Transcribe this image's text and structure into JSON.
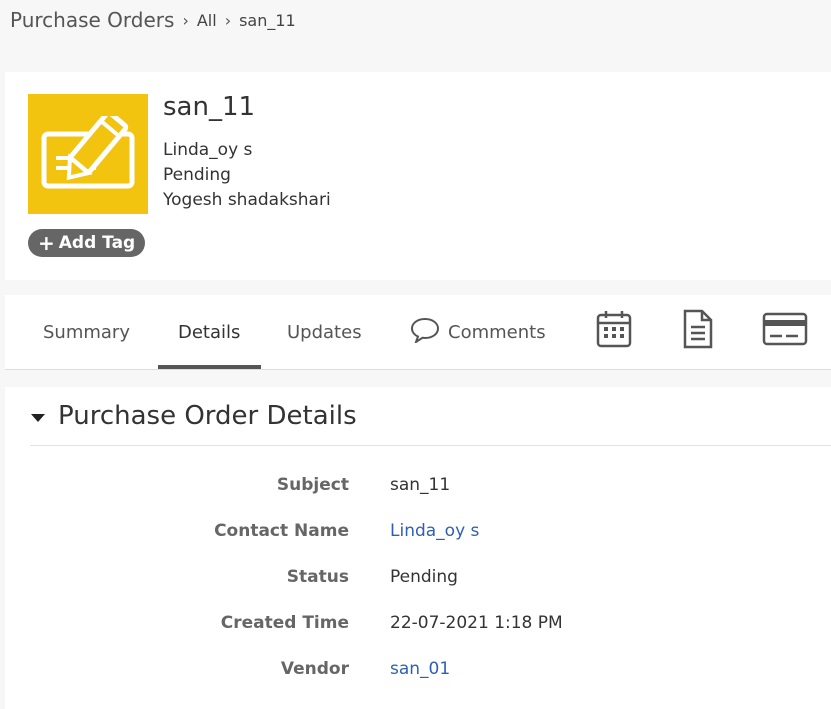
{
  "breadcrumb": {
    "module": "Purchase Orders",
    "all": "All",
    "record": "san_11"
  },
  "header": {
    "title": "san_11",
    "lines": [
      "Linda_oy s",
      "Pending",
      "Yogesh shadakshari"
    ],
    "add_tag": "Add Tag",
    "icon": "edit-note-icon",
    "icon_bg": "#f2c40f"
  },
  "tabs": {
    "items": [
      {
        "label": "Summary"
      },
      {
        "label": "Details"
      },
      {
        "label": "Updates"
      },
      {
        "label": "Comments",
        "icon": "speech-bubble-icon"
      }
    ],
    "active": "Details",
    "icon_tabs": [
      "calendar-icon",
      "document-icon",
      "card-icon"
    ]
  },
  "details": {
    "section_title": "Purchase Order Details",
    "rows": [
      {
        "label": "Subject",
        "value": "san_11",
        "link": false
      },
      {
        "label": "Contact Name",
        "value": "Linda_oy s",
        "link": true
      },
      {
        "label": "Status",
        "value": "Pending",
        "link": false
      },
      {
        "label": "Created Time",
        "value": "22-07-2021 1:18 PM",
        "link": false
      },
      {
        "label": "Vendor",
        "value": "san_01",
        "link": true
      }
    ]
  },
  "colors": {
    "link": "#2f5fb3",
    "tag_bg": "#666666"
  }
}
